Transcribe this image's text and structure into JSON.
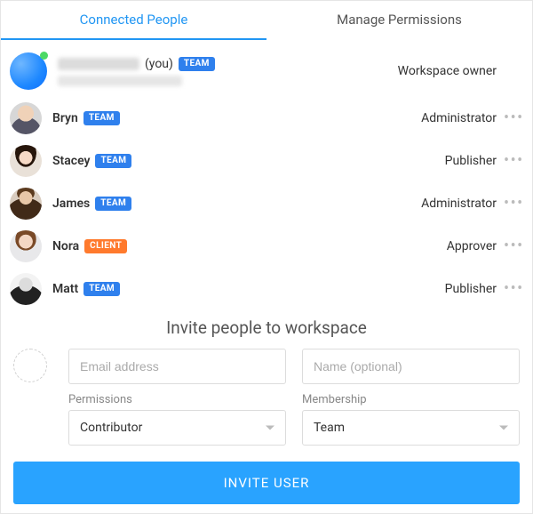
{
  "tabs": {
    "connected": "Connected People",
    "permissions": "Manage Permissions",
    "active": "connected"
  },
  "badges": {
    "team": "TEAM",
    "client": "CLIENT"
  },
  "people": [
    {
      "name_hidden": true,
      "you_suffix": "(you)",
      "badge": "team",
      "role": "Workspace owner",
      "has_more": false,
      "avatar": "self",
      "online": true,
      "email_hidden": true
    },
    {
      "name": "Bryn",
      "badge": "team",
      "role": "Administrator",
      "has_more": true,
      "avatar": "bryn"
    },
    {
      "name": "Stacey",
      "badge": "team",
      "role": "Publisher",
      "has_more": true,
      "avatar": "stacey"
    },
    {
      "name": "James",
      "badge": "team",
      "role": "Administrator",
      "has_more": true,
      "avatar": "james"
    },
    {
      "name": "Nora",
      "badge": "client",
      "role": "Approver",
      "has_more": true,
      "avatar": "nora"
    },
    {
      "name": "Matt",
      "badge": "team",
      "role": "Publisher",
      "has_more": true,
      "avatar": "matt"
    }
  ],
  "invite": {
    "title": "Invite people to workspace",
    "email_placeholder": "Email address",
    "name_placeholder": "Name (optional)",
    "permissions_label": "Permissions",
    "permissions_value": "Contributor",
    "membership_label": "Membership",
    "membership_value": "Team",
    "button": "INVITE USER"
  },
  "glyphs": {
    "more": "•••"
  }
}
